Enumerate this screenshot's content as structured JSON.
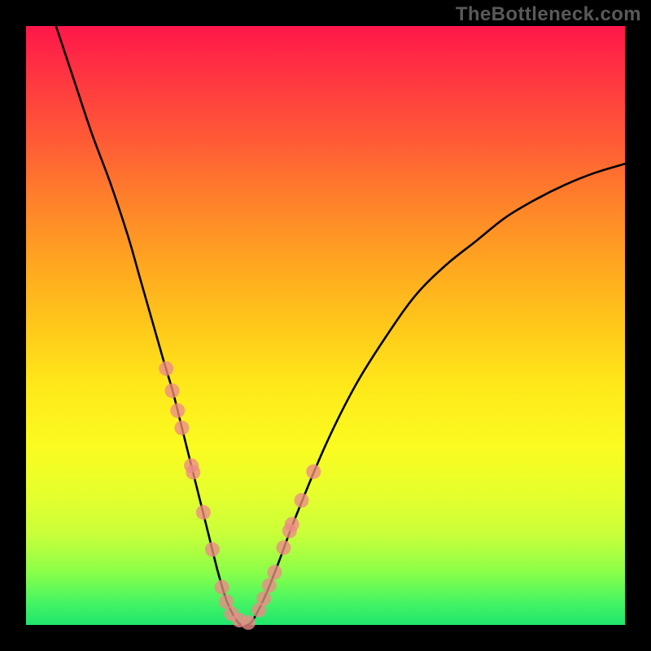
{
  "watermark": "TheBottleneck.com",
  "colors": {
    "black": "#000000",
    "curve": "#000000",
    "marker": "#ed8b87"
  },
  "chart_data": {
    "type": "line",
    "title": "",
    "xlabel": "",
    "ylabel": "",
    "xlim": [
      0,
      100
    ],
    "ylim": [
      0,
      100
    ],
    "grid": false,
    "legend": false,
    "series": [
      {
        "name": "bottleneck-curve",
        "x": [
          5,
          8,
          11,
          14,
          17,
          19,
          21,
          23,
          24.5,
          26,
          27.5,
          29,
          30.5,
          32,
          33.5,
          35,
          36,
          37,
          38,
          40,
          42,
          45,
          50,
          55,
          60,
          65,
          70,
          75,
          80,
          85,
          90,
          95,
          100
        ],
        "y": [
          100,
          91,
          82,
          74,
          65,
          58,
          51,
          44,
          39,
          33,
          27,
          21,
          15,
          9,
          4,
          1,
          0,
          0,
          1,
          5,
          10,
          18,
          30,
          40,
          48,
          55,
          60,
          64,
          68,
          71,
          73.5,
          75.5,
          77
        ]
      }
    ],
    "markers": {
      "name": "highlighted-points",
      "x": [
        23.4,
        24.4,
        25.3,
        26.0,
        27.6,
        27.9,
        29.6,
        31.1,
        32.7,
        33.4,
        34.3,
        35.6,
        37.1,
        38.9,
        39.7,
        40.6,
        41.5,
        43.0,
        44.0,
        44.4,
        46.0,
        48.0
      ],
      "y": [
        42.8,
        39.1,
        35.8,
        32.9,
        26.6,
        25.5,
        18.8,
        12.6,
        6.3,
        3.9,
        1.9,
        0.8,
        0.4,
        2.5,
        4.4,
        6.6,
        8.8,
        12.9,
        15.7,
        16.8,
        20.8,
        25.6
      ]
    }
  }
}
